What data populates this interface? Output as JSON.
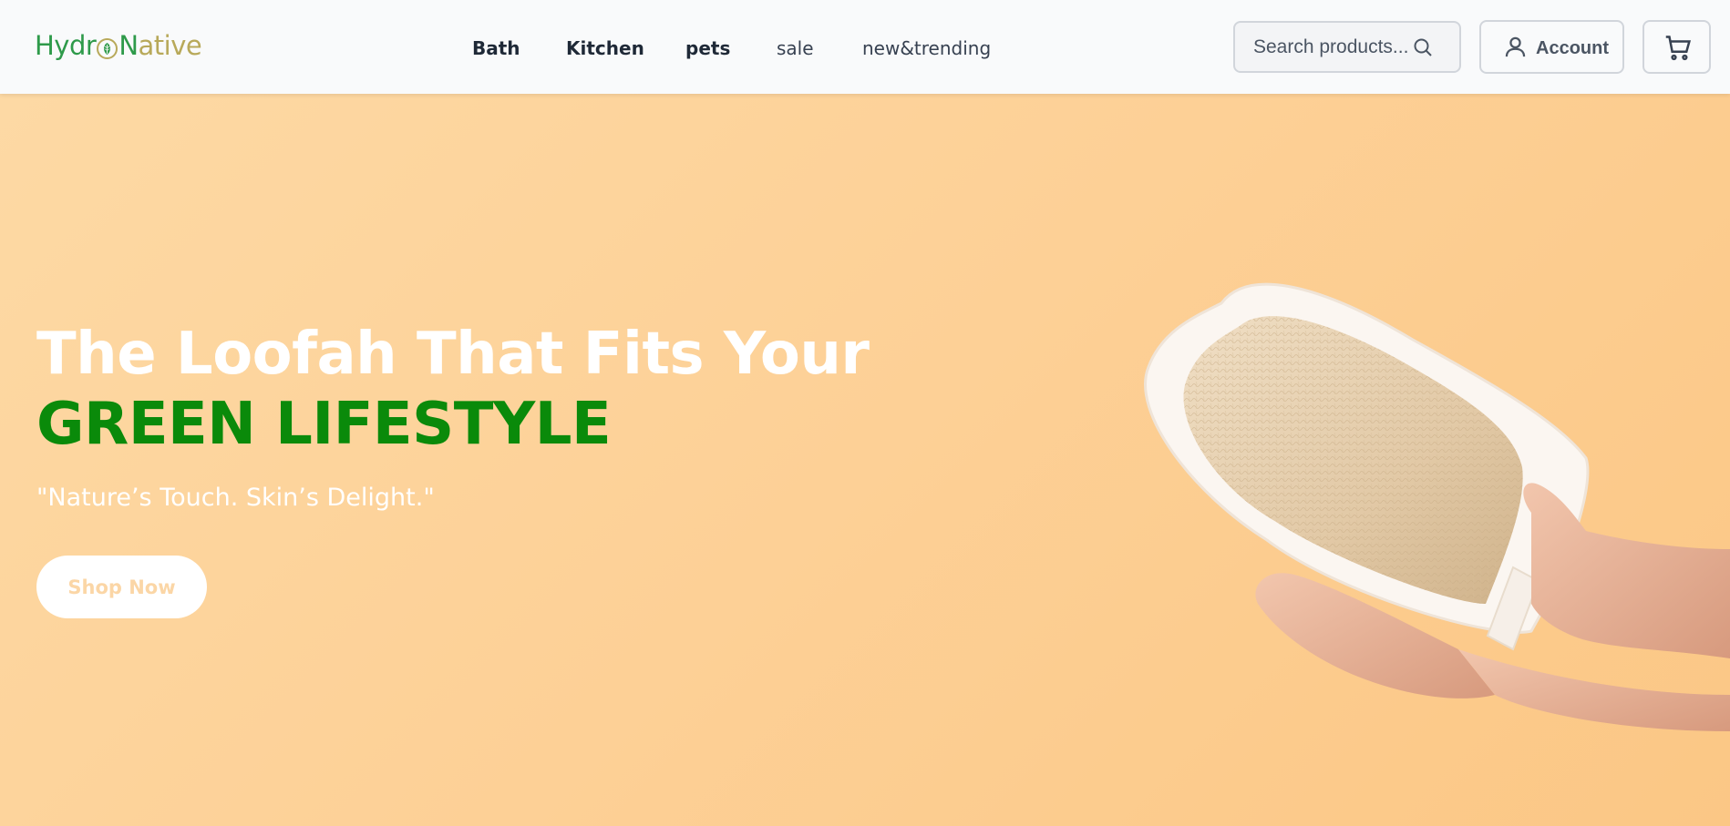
{
  "brand": {
    "logo_part1": "Hydr",
    "logo_part2": "N",
    "logo_part3": "ative",
    "colors": {
      "green": "#2e9a4a",
      "tan": "#b8a95a"
    }
  },
  "nav": {
    "items": [
      {
        "label": "Bath",
        "weight": "bold"
      },
      {
        "label": "Kitchen",
        "weight": "bold"
      },
      {
        "label": "pets",
        "weight": "bold"
      },
      {
        "label": "sale",
        "weight": "normal"
      },
      {
        "label": "new&trending",
        "weight": "normal"
      }
    ]
  },
  "search": {
    "placeholder": "Search products...",
    "icon": "search-icon"
  },
  "account": {
    "label": "Account",
    "icon": "user-icon"
  },
  "cart": {
    "icon": "cart-icon"
  },
  "hero": {
    "title_line1": "The Loofah That Fits Your",
    "title_line2": "GREEN LIFESTYLE",
    "subtitle": "\"Nature’s Touch. Skin’s Delight.\"",
    "cta_label": "Shop Now",
    "colors": {
      "background": "#fdd39b",
      "accent_green": "#0a8a0a"
    }
  }
}
